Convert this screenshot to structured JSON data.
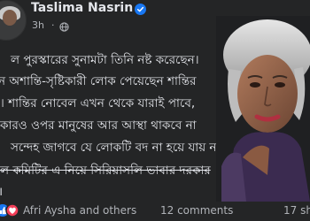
{
  "post": {
    "author": "Taslima Nasrin",
    "time": "3h",
    "time_separator": "·",
    "lines": [
      "ল পুরস্কারের সুনামটা তিনি নষ্ট করেছেন।",
      "ন অশান্তি-সৃষ্টিকারী লোক পেয়েছেন শান্তির",
      "। শান্তির নোবেল এখন থেকে যারাই পাবে,",
      "কারও ওপর মানুষের আর আস্থা থাকবে না",
      "সন্দেহ জাগবে যে লোকটি বদ না হয়ে যায় না।",
      "ল কমিটির এ নিয়ে সিরিয়াসলি ভাবার দরকার",
      "।"
    ]
  },
  "reactions": {
    "names": "Afri Aysha and others",
    "comments": "12 comments",
    "shares": "17 sh"
  },
  "colors": {
    "background": "#242526",
    "text": "#e4e6eb",
    "secondary_text": "#b0b3b8",
    "verified": "#1877f2"
  },
  "icons": {
    "verified": "verified-check-icon",
    "audience": "globe-icon",
    "like": "like-reaction-icon",
    "love": "love-reaction-icon"
  }
}
